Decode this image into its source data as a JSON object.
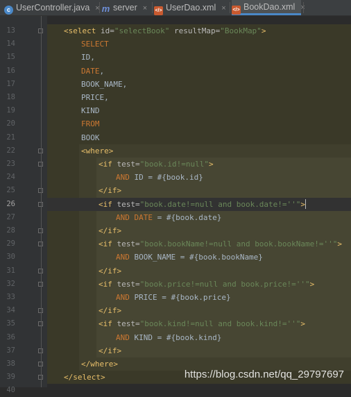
{
  "tabs": [
    {
      "name": "UserController.java",
      "icon": "java-class-icon",
      "icon_glyph": "c",
      "kind": "java",
      "active": false
    },
    {
      "name": "server",
      "icon": "maven-module-icon",
      "icon_glyph": "m",
      "kind": "maven",
      "active": false
    },
    {
      "name": "UserDao.xml",
      "icon": "xml-file-icon",
      "icon_glyph": "</>",
      "kind": "xml",
      "active": false
    },
    {
      "name": "BookDao.xml",
      "icon": "xml-file-icon",
      "icon_glyph": "</>",
      "kind": "xml",
      "active": true
    }
  ],
  "tab_close_glyph": "×",
  "watermark": "https://blog.csdn.net/qq_29797697",
  "current_line": 26,
  "lines": [
    {
      "n": "13",
      "indent": 0,
      "fold": true,
      "tokens": [
        [
          "tag",
          "<select "
        ],
        [
          "attr",
          "id="
        ],
        [
          "val",
          "\"selectBook\""
        ],
        [
          "attr",
          " resultMap="
        ],
        [
          "val",
          "\"BookMap\""
        ],
        [
          "tag",
          ">"
        ]
      ]
    },
    {
      "n": "14",
      "indent": 1,
      "fold": false,
      "tokens": [
        [
          "kw",
          "SELECT"
        ]
      ]
    },
    {
      "n": "15",
      "indent": 1,
      "fold": false,
      "tokens": [
        [
          "id",
          "ID,"
        ]
      ]
    },
    {
      "n": "16",
      "indent": 1,
      "fold": false,
      "tokens": [
        [
          "kw",
          "DATE"
        ],
        [
          "id",
          ","
        ]
      ]
    },
    {
      "n": "17",
      "indent": 1,
      "fold": false,
      "tokens": [
        [
          "id",
          "BOOK_NAME,"
        ]
      ]
    },
    {
      "n": "18",
      "indent": 1,
      "fold": false,
      "tokens": [
        [
          "id",
          "PRICE,"
        ]
      ]
    },
    {
      "n": "19",
      "indent": 1,
      "fold": false,
      "tokens": [
        [
          "id",
          "KIND"
        ]
      ]
    },
    {
      "n": "20",
      "indent": 1,
      "fold": false,
      "tokens": [
        [
          "kw",
          "FROM"
        ]
      ]
    },
    {
      "n": "21",
      "indent": 1,
      "fold": false,
      "tokens": [
        [
          "id",
          "BOOK"
        ]
      ]
    },
    {
      "n": "22",
      "indent": 1,
      "fold": true,
      "tokens": [
        [
          "tag",
          "<where>"
        ]
      ]
    },
    {
      "n": "23",
      "indent": 2,
      "fold": true,
      "tokens": [
        [
          "tag",
          "<if "
        ],
        [
          "attr",
          "test="
        ],
        [
          "val",
          "\"book.id!=null\""
        ],
        [
          "tag",
          ">"
        ]
      ]
    },
    {
      "n": "24",
      "indent": 3,
      "fold": false,
      "tokens": [
        [
          "kw",
          "AND"
        ],
        [
          "id",
          " ID = #{book.id}"
        ]
      ]
    },
    {
      "n": "25",
      "indent": 2,
      "fold": true,
      "tokens": [
        [
          "tag",
          "</if>"
        ]
      ]
    },
    {
      "n": "26",
      "indent": 2,
      "fold": true,
      "bulb": true,
      "tokens": [
        [
          "tag",
          "<if "
        ],
        [
          "attr",
          "test="
        ],
        [
          "val",
          "\"book.date!=null and book.date!=''\""
        ],
        [
          "tag",
          ">"
        ]
      ]
    },
    {
      "n": "27",
      "indent": 3,
      "fold": false,
      "tokens": [
        [
          "kw",
          "AND"
        ],
        [
          "kw",
          " DATE"
        ],
        [
          "id",
          " = #{book.date}"
        ]
      ]
    },
    {
      "n": "28",
      "indent": 2,
      "fold": true,
      "tokens": [
        [
          "tag",
          "</if>"
        ]
      ]
    },
    {
      "n": "29",
      "indent": 2,
      "fold": true,
      "tokens": [
        [
          "tag",
          "<if "
        ],
        [
          "attr",
          "test="
        ],
        [
          "val",
          "\"book.bookName!=null and book.bookName!=''\""
        ],
        [
          "tag",
          ">"
        ]
      ]
    },
    {
      "n": "30",
      "indent": 3,
      "fold": false,
      "tokens": [
        [
          "kw",
          "AND"
        ],
        [
          "id",
          " BOOK_NAME = #{book.bookName}"
        ]
      ]
    },
    {
      "n": "31",
      "indent": 2,
      "fold": true,
      "tokens": [
        [
          "tag",
          "</if>"
        ]
      ]
    },
    {
      "n": "32",
      "indent": 2,
      "fold": true,
      "tokens": [
        [
          "tag",
          "<if "
        ],
        [
          "attr",
          "test="
        ],
        [
          "val",
          "\"book.price!=null and book.price!=''\""
        ],
        [
          "tag",
          ">"
        ]
      ]
    },
    {
      "n": "33",
      "indent": 3,
      "fold": false,
      "tokens": [
        [
          "kw",
          "AND"
        ],
        [
          "id",
          " PRICE = #{book.price}"
        ]
      ]
    },
    {
      "n": "34",
      "indent": 2,
      "fold": true,
      "tokens": [
        [
          "tag",
          "</if>"
        ]
      ]
    },
    {
      "n": "35",
      "indent": 2,
      "fold": true,
      "tokens": [
        [
          "tag",
          "<if "
        ],
        [
          "attr",
          "test="
        ],
        [
          "val",
          "\"book.kind!=null and book.kind!=''\""
        ],
        [
          "tag",
          ">"
        ]
      ]
    },
    {
      "n": "36",
      "indent": 3,
      "fold": false,
      "tokens": [
        [
          "kw",
          "AND"
        ],
        [
          "id",
          " KIND = #{book.kind}"
        ]
      ]
    },
    {
      "n": "37",
      "indent": 2,
      "fold": true,
      "tokens": [
        [
          "tag",
          "</if>"
        ]
      ]
    },
    {
      "n": "38",
      "indent": 1,
      "fold": true,
      "tokens": [
        [
          "tag",
          "</where>"
        ]
      ]
    },
    {
      "n": "39",
      "indent": 0,
      "fold": true,
      "tokens": [
        [
          "tag",
          "</select>"
        ]
      ]
    },
    {
      "n": "40",
      "indent": 0,
      "fold": false,
      "tokens": []
    }
  ]
}
